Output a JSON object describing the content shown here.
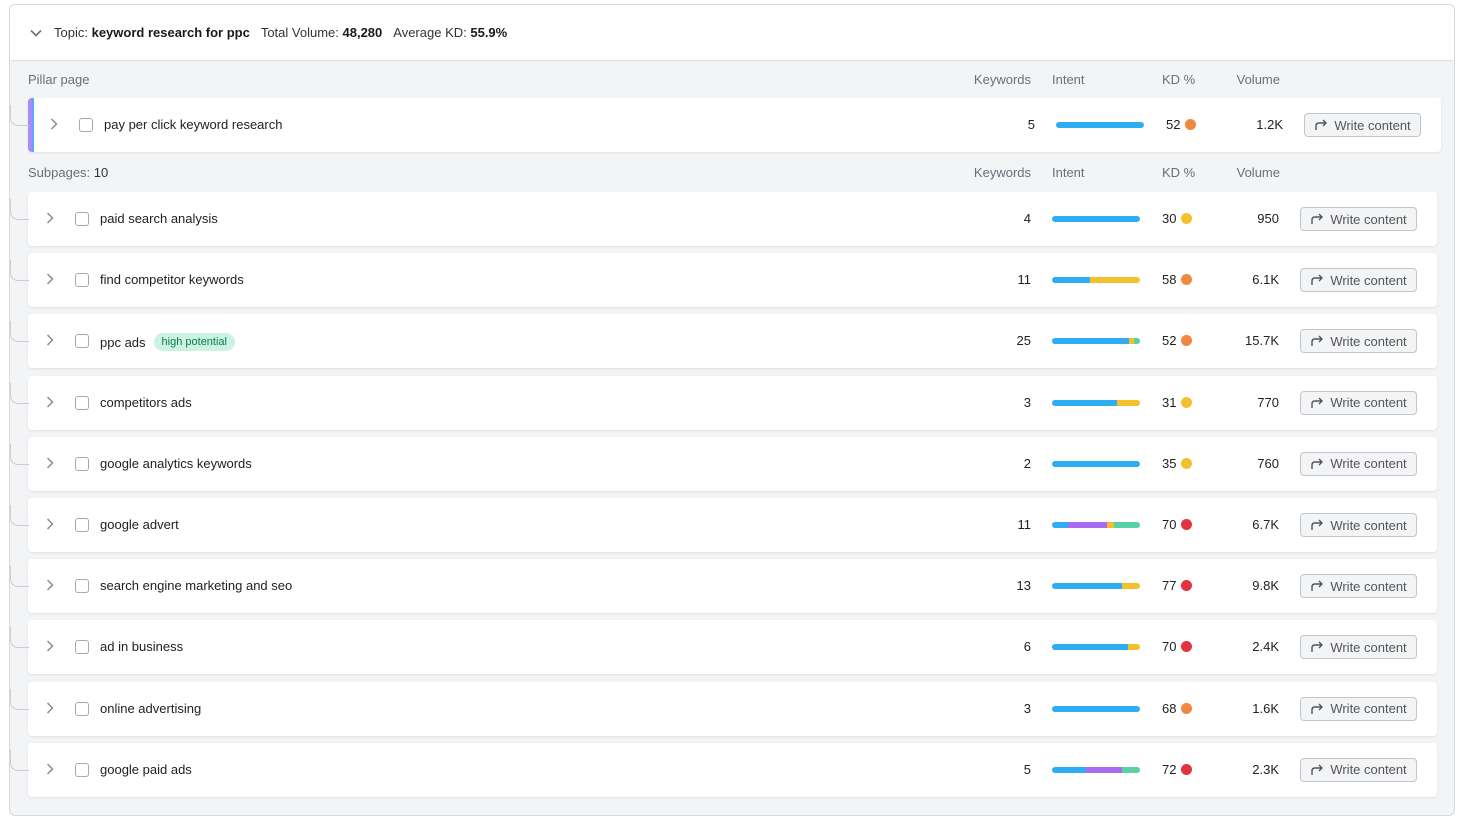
{
  "topic": {
    "topic_label": "Topic:",
    "topic_value": "keyword research for ppc",
    "volume_label": "Total Volume:",
    "volume_value": "48,280",
    "kd_label": "Average KD:",
    "kd_value": "55.9%"
  },
  "columns": {
    "keywords": "Keywords",
    "intent": "Intent",
    "kd": "KD %",
    "volume": "Volume"
  },
  "pillar": {
    "section_label": "Pillar page",
    "row": {
      "name": "pay per click keyword research",
      "keywords": "5",
      "intent": [
        {
          "color": "#2eaef0",
          "share": 1
        }
      ],
      "kd": "52",
      "kd_color": "#f0883e",
      "volume": "1.2K"
    }
  },
  "subpages": {
    "label": "Subpages:",
    "count": "10",
    "rows": [
      {
        "name": "paid search analysis",
        "keywords": "4",
        "intent": [
          {
            "color": "#2eaef0",
            "share": 1
          }
        ],
        "kd": "30",
        "kd_color": "#f5c02e",
        "volume": "950"
      },
      {
        "name": "find competitor keywords",
        "keywords": "11",
        "intent": [
          {
            "color": "#2eaef0",
            "share": 0.43
          },
          {
            "color": "#f5c02e",
            "share": 0.57
          }
        ],
        "kd": "58",
        "kd_color": "#f0883e",
        "volume": "6.1K"
      },
      {
        "name": "ppc ads",
        "badge": "high potential",
        "keywords": "25",
        "intent": [
          {
            "color": "#2eaef0",
            "share": 0.88
          },
          {
            "color": "#f5c02e",
            "share": 0.05
          },
          {
            "color": "#56d3a4",
            "share": 0.07
          }
        ],
        "kd": "52",
        "kd_color": "#f0883e",
        "volume": "15.7K"
      },
      {
        "name": "competitors ads",
        "keywords": "3",
        "intent": [
          {
            "color": "#2eaef0",
            "share": 0.74
          },
          {
            "color": "#f5c02e",
            "share": 0.26
          }
        ],
        "kd": "31",
        "kd_color": "#f5c02e",
        "volume": "770"
      },
      {
        "name": "google analytics keywords",
        "keywords": "2",
        "intent": [
          {
            "color": "#2eaef0",
            "share": 1
          }
        ],
        "kd": "35",
        "kd_color": "#f5c02e",
        "volume": "760"
      },
      {
        "name": "google advert",
        "keywords": "11",
        "intent": [
          {
            "color": "#2eaef0",
            "share": 0.18
          },
          {
            "color": "#a66bf0",
            "share": 0.45
          },
          {
            "color": "#f5c02e",
            "share": 0.08
          },
          {
            "color": "#56d3a4",
            "share": 0.29
          }
        ],
        "kd": "70",
        "kd_color": "#e5323f",
        "volume": "6.7K"
      },
      {
        "name": "search engine marketing and seo",
        "keywords": "13",
        "intent": [
          {
            "color": "#2eaef0",
            "share": 0.8
          },
          {
            "color": "#f5c02e",
            "share": 0.2
          }
        ],
        "kd": "77",
        "kd_color": "#e5323f",
        "volume": "9.8K"
      },
      {
        "name": "ad in business",
        "keywords": "6",
        "intent": [
          {
            "color": "#2eaef0",
            "share": 0.86
          },
          {
            "color": "#f5c02e",
            "share": 0.14
          }
        ],
        "kd": "70",
        "kd_color": "#e5323f",
        "volume": "2.4K"
      },
      {
        "name": "online advertising",
        "keywords": "3",
        "intent": [
          {
            "color": "#2eaef0",
            "share": 1
          }
        ],
        "kd": "68",
        "kd_color": "#f0883e",
        "volume": "1.6K"
      },
      {
        "name": "google paid ads",
        "keywords": "5",
        "intent": [
          {
            "color": "#2eaef0",
            "share": 0.39
          },
          {
            "color": "#a66bf0",
            "share": 0.4
          },
          {
            "color": "#56d3a4",
            "share": 0.21
          }
        ],
        "kd": "72",
        "kd_color": "#e5323f",
        "volume": "2.3K"
      }
    ]
  },
  "actions": {
    "write_content": "Write content"
  },
  "icons": {
    "toggle": "chevron-down-icon",
    "row_expand": "chevron-right-icon",
    "write": "share-arrow-icon"
  }
}
